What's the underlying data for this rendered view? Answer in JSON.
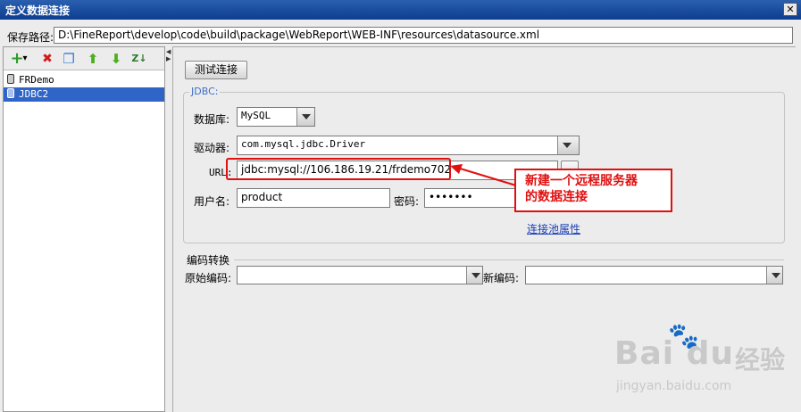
{
  "window": {
    "title": "定义数据连接",
    "close_label": "✕"
  },
  "save_path": {
    "label": "保存路径:",
    "value": "D:\\FineReport\\develop\\code\\build\\package\\WebReport\\WEB-INF\\resources\\datasource.xml"
  },
  "toolbar": {
    "add": "+",
    "add_dropdown": "▾",
    "delete": "✖",
    "copy": "❐",
    "move_up": "⬆",
    "move_down": "⬇",
    "sort": "Z↓"
  },
  "connections": [
    {
      "name": "FRDemo",
      "selected": false
    },
    {
      "name": "JDBC2",
      "selected": true
    }
  ],
  "test_button": "测试连接",
  "jdbc": {
    "group_title": "JDBC:",
    "database_label": "数据库:",
    "database_value": "MySQL",
    "driver_label": "驱动器:",
    "driver_value": "com.mysql.jdbc.Driver",
    "url_label": "URL:",
    "url_value": "jdbc:mysql://106.186.19.21/frdemo702",
    "user_label": "用户名:",
    "user_value": "product",
    "password_label": "密码:",
    "password_value": "•••••••",
    "pool_link": "连接池属性"
  },
  "encoding": {
    "title": "编码转换",
    "original_label": "原始编码:",
    "original_value": "",
    "new_label": "新编码:",
    "new_value": ""
  },
  "callout": {
    "line1": "新建一个远程服务器",
    "line2": "的数据连接"
  },
  "watermark": {
    "logo": "Bai  du",
    "cn": "经验",
    "url": "jingyan.baidu.com"
  },
  "colors": {
    "selection": "#2f65c7",
    "callout": "#e01010",
    "group_title": "#3f6ec6"
  }
}
